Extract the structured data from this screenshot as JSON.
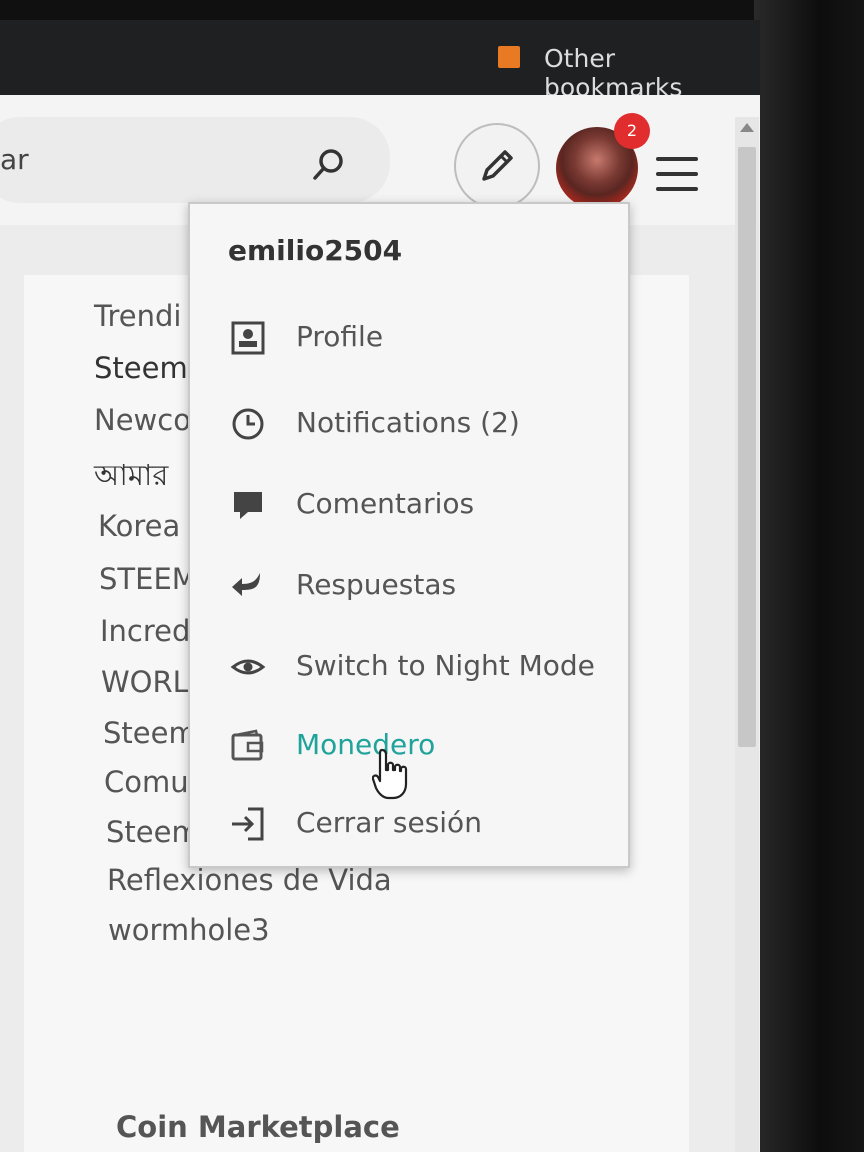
{
  "browser": {
    "bookmarks_label": "Other bookmarks",
    "search_label": "ar"
  },
  "header": {
    "notification_count": "2"
  },
  "sidebar": {
    "items": [
      "Trendi",
      "Steem",
      "Newco",
      "আমার",
      "Korea",
      "STEEM",
      "Incred",
      "WORLI",
      "Steem",
      "Comur",
      "Steem",
      "Reflexiones de Vida",
      "wormhole3"
    ],
    "section_title": "Coin Marketplace"
  },
  "dropdown": {
    "username": "emilio2504",
    "items": [
      {
        "label": "Profile",
        "icon": "profile-icon"
      },
      {
        "label": "Notifications (2)",
        "icon": "clock-icon"
      },
      {
        "label": "Comentarios",
        "icon": "comment-icon"
      },
      {
        "label": "Respuestas",
        "icon": "reply-icon"
      },
      {
        "label": "Switch to Night Mode",
        "icon": "eye-icon"
      },
      {
        "label": "Monedero",
        "icon": "wallet-icon"
      },
      {
        "label": "Cerrar sesión",
        "icon": "logout-icon"
      }
    ],
    "active_item": "Monedero",
    "accent_color": "#1fa39a"
  },
  "colors": {
    "badge": "#e12d2d",
    "bookmark_folder": "#e87a24"
  }
}
